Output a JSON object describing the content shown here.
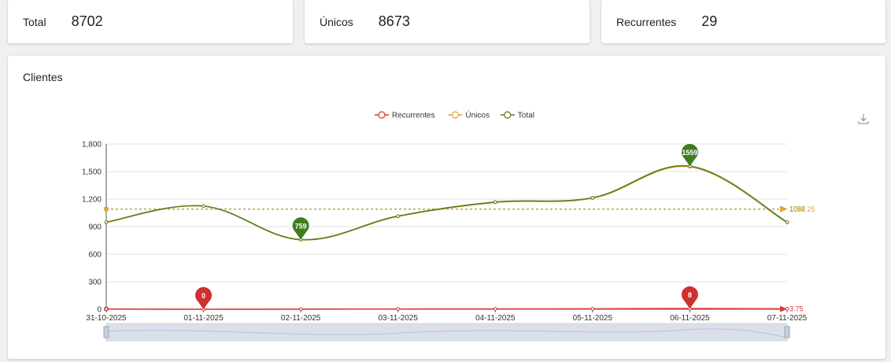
{
  "stats": [
    {
      "label": "Total",
      "value": "8702"
    },
    {
      "label": "Únicos",
      "value": "8673"
    },
    {
      "label": "Recurrentes",
      "value": "29"
    }
  ],
  "chart_title": "Clientes",
  "chart_data": {
    "type": "line",
    "categories": [
      "31-10-2025",
      "01-11-2025",
      "02-11-2025",
      "03-11-2025",
      "04-11-2025",
      "05-11-2025",
      "06-11-2025",
      "07-11-2025"
    ],
    "series": [
      {
        "name": "Recurrentes",
        "color": "#d93838",
        "values": [
          3,
          0,
          2,
          3,
          4,
          5,
          8,
          5
        ]
      },
      {
        "name": "Únicos",
        "color": "#e6a23c",
        "values": [
          946,
          1124,
          757,
          1012,
          1164,
          1210,
          1551,
          944
        ]
      },
      {
        "name": "Total",
        "color": "#5a7d1e",
        "values": [
          949,
          1124,
          759,
          1015,
          1168,
          1215,
          1559,
          949
        ]
      }
    ],
    "ylim": [
      0,
      1800
    ],
    "yticks": [
      "0",
      "300",
      "600",
      "900",
      "1,200",
      "1,500",
      "1,800"
    ],
    "legend_position": "top-center",
    "grid": true,
    "mark_points": [
      {
        "series": "Total",
        "label": "759",
        "category": "02-11-2025",
        "value": 759,
        "color": "#3f7d20"
      },
      {
        "series": "Total",
        "label": "1559",
        "category": "06-11-2025",
        "value": 1559,
        "color": "#3f7d20"
      },
      {
        "series": "Recurrentes",
        "label": "0",
        "category": "01-11-2025",
        "value": 0,
        "color": "#cf3030"
      },
      {
        "series": "Recurrentes",
        "label": "8",
        "category": "06-11-2025",
        "value": 8,
        "color": "#cf3030"
      }
    ],
    "mark_lines": [
      {
        "series": "Total",
        "value": 1092,
        "label": "1092",
        "color": "#5a7d1e"
      },
      {
        "series": "Únicos",
        "value": 1088.25,
        "label": "1088.25",
        "color": "#e6a23c"
      },
      {
        "series": "Recurrentes",
        "value": 3.75,
        "label": "3.75",
        "color": "#d93838"
      }
    ]
  },
  "download_icon": "download-icon"
}
